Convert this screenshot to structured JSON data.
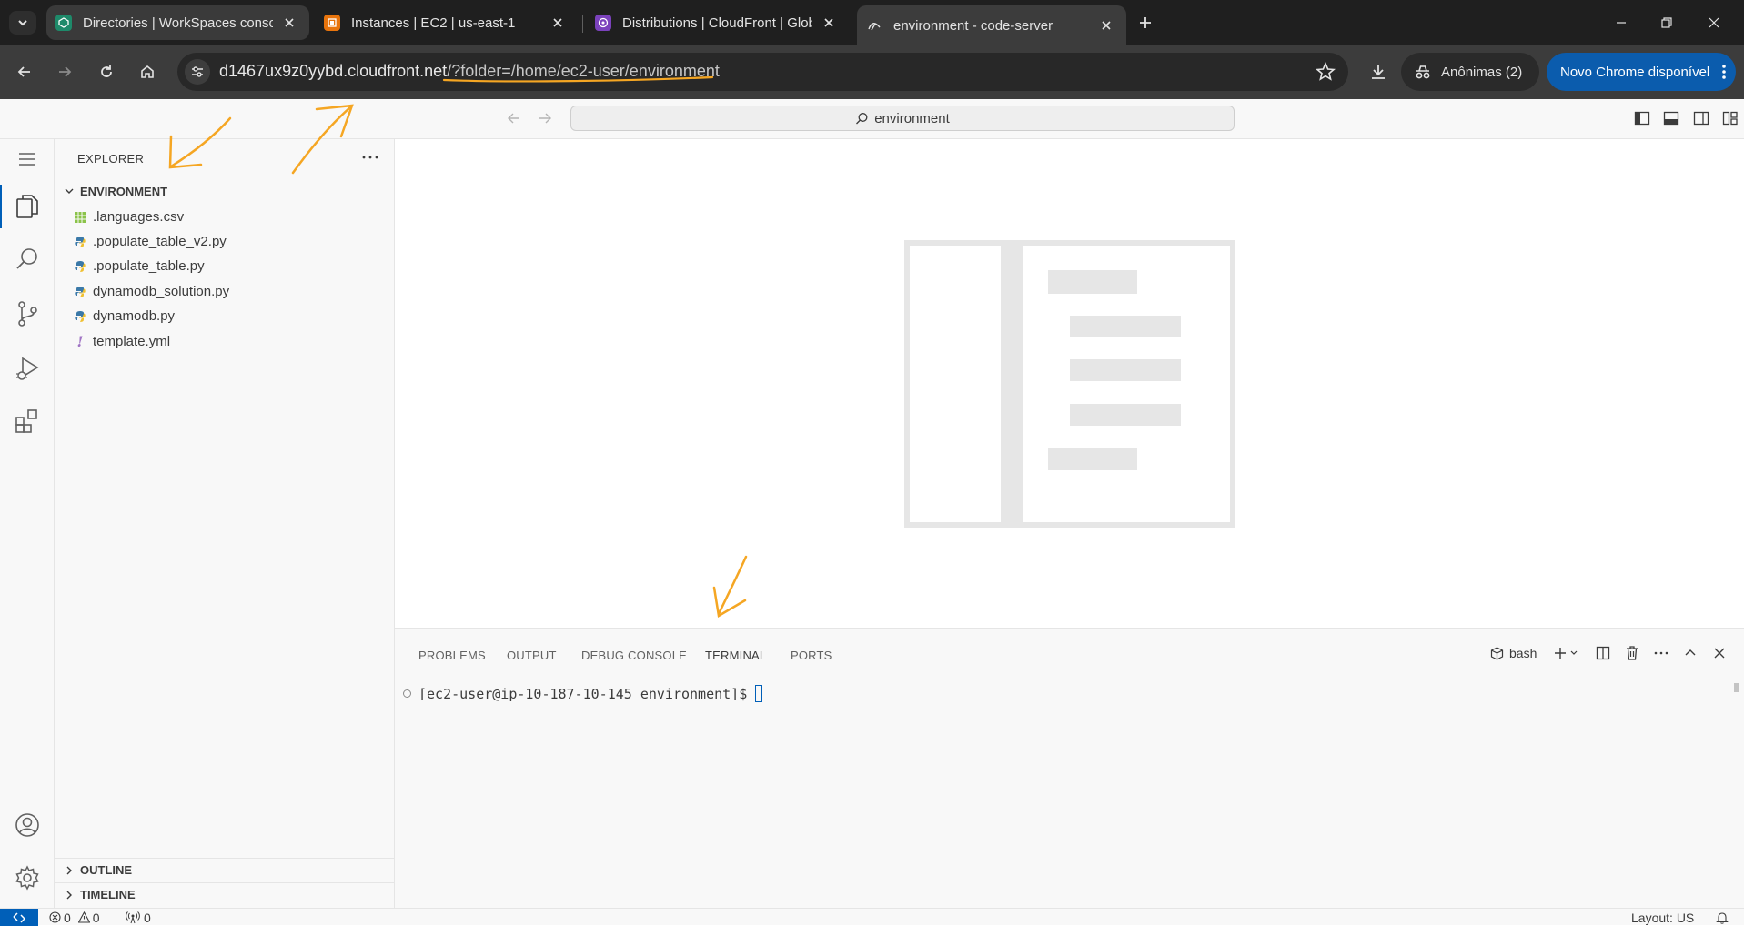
{
  "browser": {
    "tabs": [
      {
        "title": "Directories | WorkSpaces console",
        "icon": "workspaces-icon",
        "active": false
      },
      {
        "title": "Instances | EC2 | us-east-1",
        "icon": "ec2-icon",
        "active": false
      },
      {
        "title": "Distributions | CloudFront | Global",
        "icon": "cloudfront-icon",
        "active": false
      },
      {
        "title": "environment - code-server",
        "icon": "code-server-icon",
        "active": true
      }
    ],
    "url_host": "d1467ux9z0yybd.cloudfront.net",
    "url_path": "/?folder=/home/ec2-user/environment",
    "incognito_label": "Anônimas (2)",
    "update_label": "Novo Chrome disponível"
  },
  "titlebar": {
    "search_text": "environment"
  },
  "sidebar": {
    "title": "EXPLORER",
    "folder_name": "ENVIRONMENT",
    "files": [
      {
        "name": ".languages.csv",
        "icon": "csv-file-icon",
        "color": "#8bc34a"
      },
      {
        "name": ".populate_table_v2.py",
        "icon": "python-file-icon",
        "color": "#3b79a8"
      },
      {
        "name": ".populate_table.py",
        "icon": "python-file-icon",
        "color": "#3b79a8"
      },
      {
        "name": "dynamodb_solution.py",
        "icon": "python-file-icon",
        "color": "#3b79a8"
      },
      {
        "name": "dynamodb.py",
        "icon": "python-file-icon",
        "color": "#3b79a8"
      },
      {
        "name": "template.yml",
        "icon": "yaml-file-icon",
        "color": "#a074c4"
      }
    ],
    "outline_label": "OUTLINE",
    "timeline_label": "TIMELINE"
  },
  "panel": {
    "tabs": [
      "PROBLEMS",
      "OUTPUT",
      "DEBUG CONSOLE",
      "TERMINAL",
      "PORTS"
    ],
    "active_tab": "TERMINAL",
    "shell_label": "bash",
    "terminal_prompt": "[ec2-user@ip-10-187-10-145 environment]$"
  },
  "statusbar": {
    "errors": "0",
    "warnings": "0",
    "ports": "0",
    "layout": "Layout: US"
  },
  "colors": {
    "accent": "#005fb8",
    "annotation": "#f5a623",
    "chrome_dark": "#1f1f1f"
  }
}
